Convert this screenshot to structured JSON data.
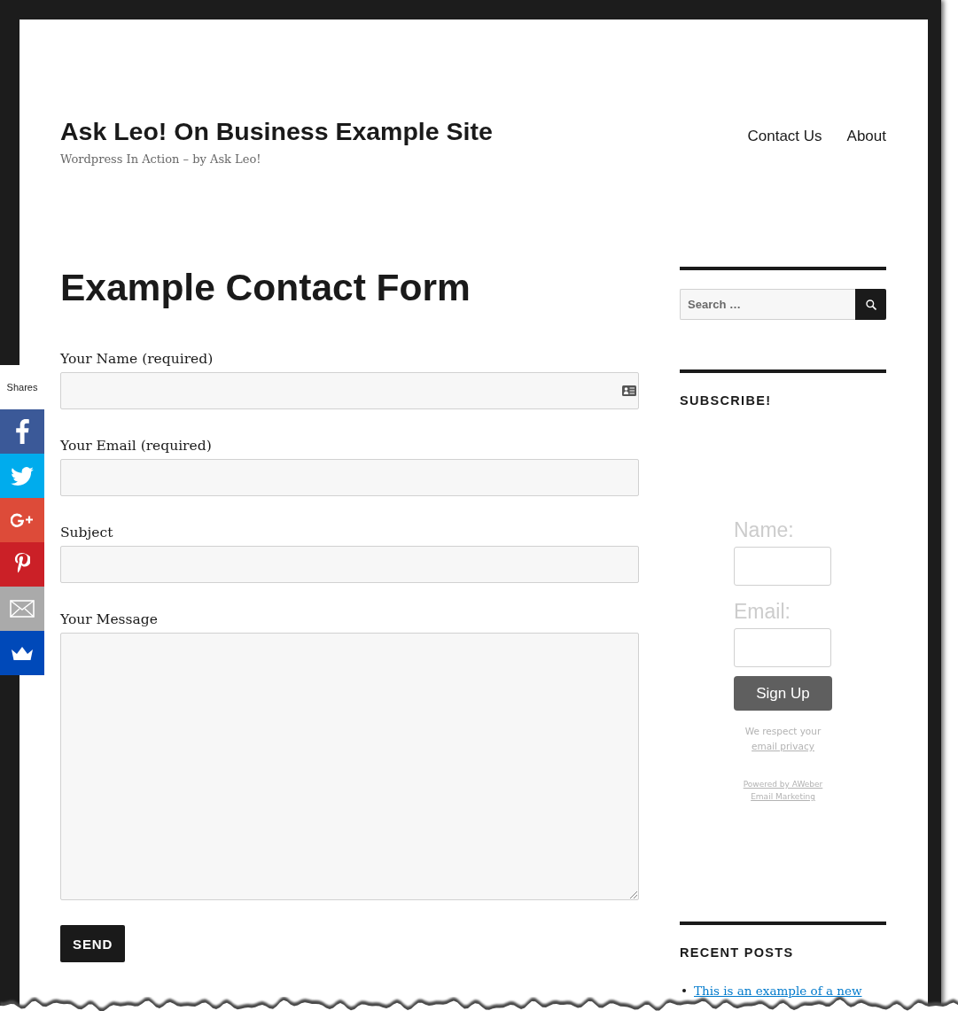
{
  "site": {
    "title": "Ask Leo! On Business Example Site",
    "tagline": "Wordpress In Action – by Ask Leo!"
  },
  "nav": [
    {
      "label": "Contact Us"
    },
    {
      "label": "About"
    }
  ],
  "main": {
    "title": "Example Contact Form",
    "fields": [
      {
        "kind": "text",
        "label": "Your Name (required)",
        "contact_card_icon": true
      },
      {
        "kind": "text",
        "label": "Your Email (required)",
        "contact_card_icon": false
      },
      {
        "kind": "text",
        "label": "Subject",
        "contact_card_icon": false
      },
      {
        "kind": "textarea",
        "label": "Your Message",
        "contact_card_icon": false
      }
    ],
    "submit": "SEND"
  },
  "sidebar": {
    "search": {
      "placeholder": "Search …"
    },
    "subscribe": {
      "title": "SUBSCRIBE!",
      "name_label": "Name:",
      "email_label": "Email:",
      "button": "Sign Up",
      "privacy_text": "We respect your",
      "privacy_link": "email privacy",
      "powered_by": "Powered by AWeber Email Marketing"
    },
    "recent_posts": {
      "title": "RECENT POSTS",
      "posts": [
        "This is an example of a new"
      ]
    }
  },
  "share_bar": {
    "label": "Shares",
    "buttons": [
      {
        "kind": "facebook",
        "color": "#3b5998"
      },
      {
        "kind": "twitter",
        "color": "#00aced"
      },
      {
        "kind": "google_plus",
        "color": "#dd4b39"
      },
      {
        "kind": "pinterest",
        "color": "#cb2027"
      },
      {
        "kind": "email",
        "color": "#aaaaaa"
      },
      {
        "kind": "crown",
        "color": "#0049b9"
      }
    ]
  }
}
